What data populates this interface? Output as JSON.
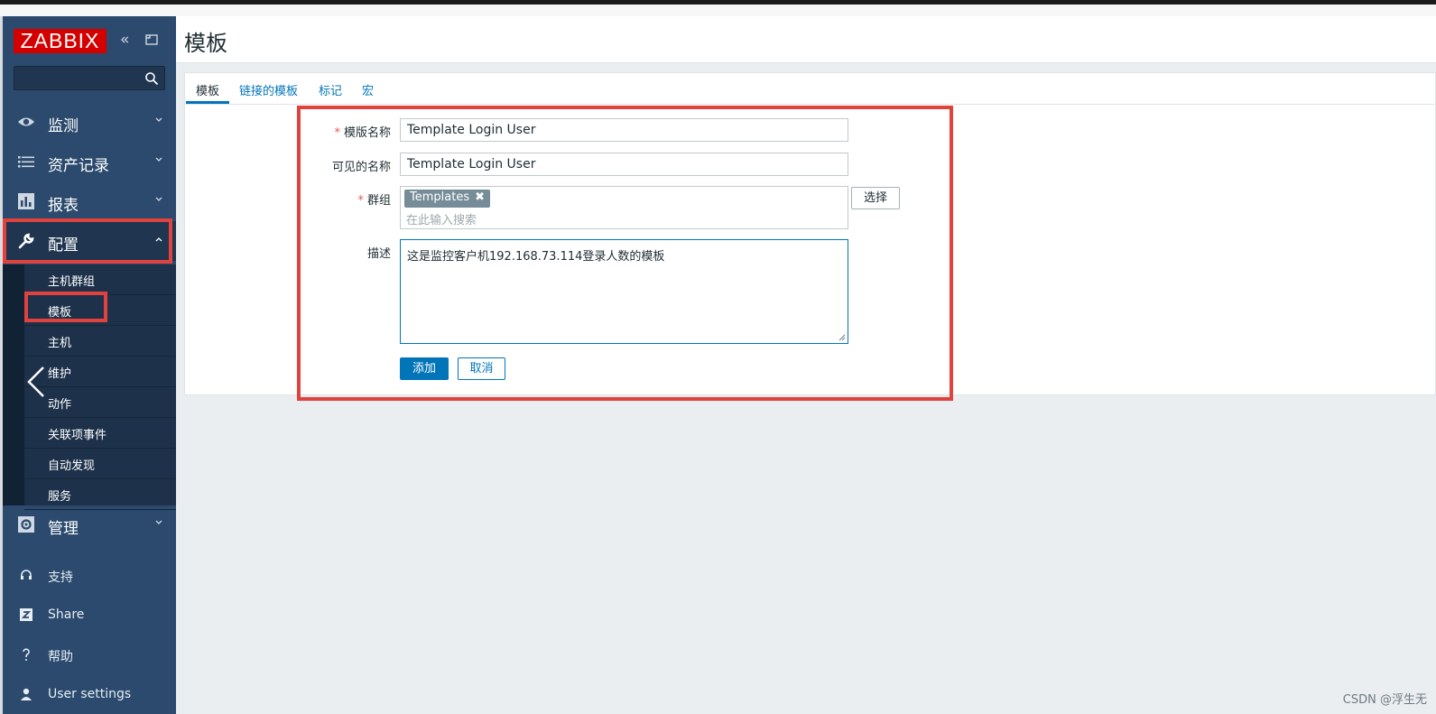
{
  "app": {
    "logo_text": "ZABBIX",
    "page_title": "模板"
  },
  "sidebar": {
    "search_placeholder": "",
    "menu": [
      {
        "label": "监测",
        "icon": "eye-icon"
      },
      {
        "label": "资产记录",
        "icon": "list-icon"
      },
      {
        "label": "报表",
        "icon": "bar-chart-icon"
      },
      {
        "label": "配置",
        "icon": "wrench-icon"
      },
      {
        "label": "管理",
        "icon": "gear-icon"
      }
    ],
    "submenu": [
      {
        "label": "主机群组"
      },
      {
        "label": "模板"
      },
      {
        "label": "主机"
      },
      {
        "label": "维护"
      },
      {
        "label": "动作"
      },
      {
        "label": "关联项事件"
      },
      {
        "label": "自动发现"
      },
      {
        "label": "服务"
      }
    ],
    "footer": [
      {
        "label": "支持",
        "icon": "headset-icon"
      },
      {
        "label": "Share",
        "icon": "share-icon"
      },
      {
        "label": "帮助",
        "icon": "help-icon"
      },
      {
        "label": "User settings",
        "icon": "user-icon"
      }
    ]
  },
  "tabs": [
    {
      "label": "模板"
    },
    {
      "label": "链接的模板"
    },
    {
      "label": "标记"
    },
    {
      "label": "宏"
    }
  ],
  "form": {
    "template_name": {
      "label": "模版名称",
      "required_mark": "*",
      "value": "Template Login User"
    },
    "visible_name": {
      "label": "可见的名称",
      "value": "Template Login User"
    },
    "groups": {
      "label": "群组",
      "required_mark": "*",
      "chip": "Templates",
      "chip_remove": "✖",
      "placeholder": "在此输入搜索",
      "select_label": "选择"
    },
    "description": {
      "label": "描述",
      "value": "这是监控客户机192.168.73.114登录人数的模板"
    },
    "add_label": "添加",
    "cancel_label": "取消"
  },
  "watermark": "CSDN @浮生无",
  "colors": {
    "sidebar_bg": "#2b4a6d",
    "logo_bg": "#d40000",
    "accent": "#0275b8",
    "highlight": "#e0423d"
  }
}
